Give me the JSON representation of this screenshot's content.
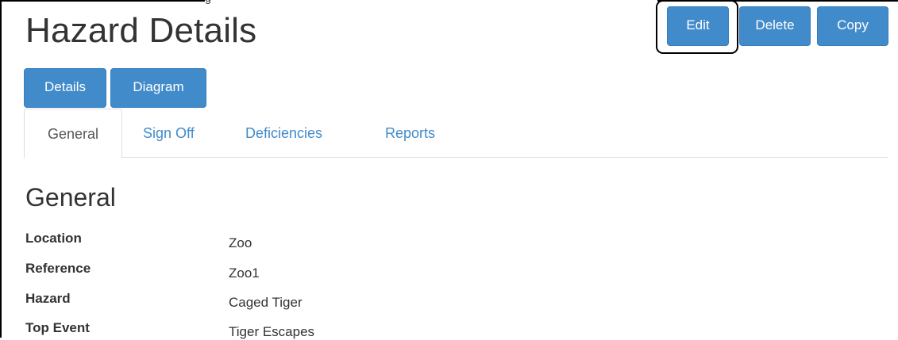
{
  "header": {
    "title": "Hazard Details",
    "clipped_text": "g"
  },
  "actions": {
    "edit_label": "Edit",
    "delete_label": "Delete",
    "copy_label": "Copy"
  },
  "views": {
    "details_label": "Details",
    "diagram_label": "Diagram"
  },
  "tabs": [
    {
      "label": "General",
      "active": true
    },
    {
      "label": "Sign Off",
      "active": false
    },
    {
      "label": "Deficiencies",
      "active": false
    },
    {
      "label": "Reports",
      "active": false
    }
  ],
  "section": {
    "title": "General",
    "fields": [
      {
        "label": "Location",
        "value": "Zoo"
      },
      {
        "label": "Reference",
        "value": "Zoo1"
      },
      {
        "label": "Hazard",
        "value": "Caged Tiger"
      },
      {
        "label": "Top Event",
        "value": "Tiger Escapes"
      }
    ]
  },
  "colors": {
    "primary": "#428bca",
    "primary_border": "#357ebd",
    "link": "#428bca",
    "text": "#333333",
    "tab_border": "#dddddd"
  }
}
